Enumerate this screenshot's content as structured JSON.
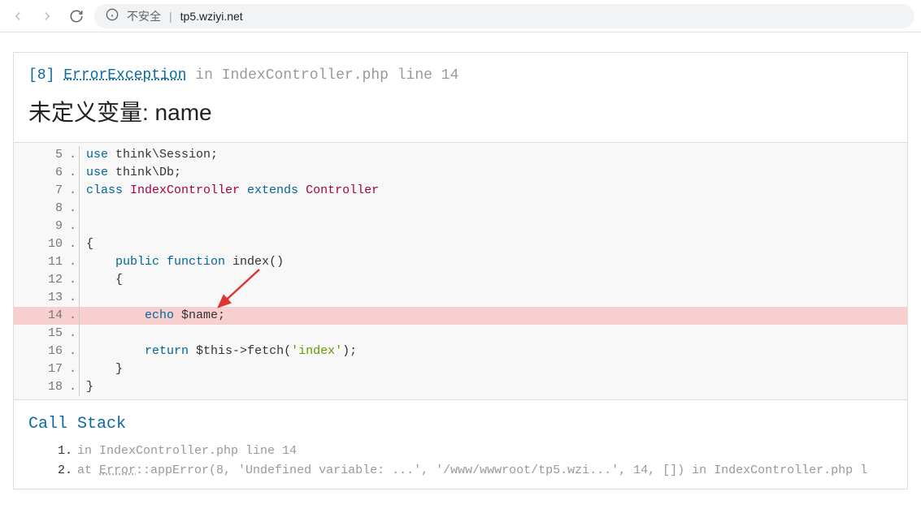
{
  "browser": {
    "security_label": "不安全",
    "url": "tp5.wziyi.net"
  },
  "error": {
    "code": "[8]",
    "exception": "ErrorException",
    "in_word": "in",
    "file": "IndexController.php",
    "line_word": "line",
    "line_no": "14",
    "title": "未定义变量: name"
  },
  "code": {
    "lines": [
      {
        "n": "5",
        "ind": "",
        "tokens": [
          {
            "t": "use ",
            "c": "kw"
          },
          {
            "t": "think\\Session",
            "c": "pn"
          },
          {
            "t": ";",
            "c": "pn"
          }
        ]
      },
      {
        "n": "6",
        "ind": "",
        "tokens": [
          {
            "t": "use ",
            "c": "kw"
          },
          {
            "t": "think\\Db",
            "c": "pn"
          },
          {
            "t": ";",
            "c": "pn"
          }
        ]
      },
      {
        "n": "7",
        "ind": "",
        "tokens": [
          {
            "t": "class ",
            "c": "kw"
          },
          {
            "t": "IndexController",
            "c": "cls"
          },
          {
            "t": " extends ",
            "c": "kw"
          },
          {
            "t": "Controller",
            "c": "cls"
          }
        ]
      },
      {
        "n": "8",
        "ind": "",
        "tokens": []
      },
      {
        "n": "9",
        "ind": "",
        "tokens": []
      },
      {
        "n": "10",
        "ind": "",
        "tokens": [
          {
            "t": "{",
            "c": "pn"
          }
        ]
      },
      {
        "n": "11",
        "ind": "    ",
        "tokens": [
          {
            "t": "public ",
            "c": "kw"
          },
          {
            "t": "function ",
            "c": "kw"
          },
          {
            "t": "index",
            "c": "fn"
          },
          {
            "t": "()",
            "c": "pn"
          }
        ]
      },
      {
        "n": "12",
        "ind": "    ",
        "tokens": [
          {
            "t": "{",
            "c": "pn"
          }
        ]
      },
      {
        "n": "13",
        "ind": "",
        "tokens": []
      },
      {
        "n": "14",
        "hl": true,
        "ind": "        ",
        "tokens": [
          {
            "t": "echo ",
            "c": "kw"
          },
          {
            "t": "$name",
            "c": "var"
          },
          {
            "t": ";",
            "c": "pn"
          }
        ]
      },
      {
        "n": "15",
        "ind": "",
        "tokens": []
      },
      {
        "n": "16",
        "ind": "        ",
        "tokens": [
          {
            "t": "return ",
            "c": "kw"
          },
          {
            "t": "$this",
            "c": "var"
          },
          {
            "t": "->",
            "c": "pn"
          },
          {
            "t": "fetch",
            "c": "fn"
          },
          {
            "t": "(",
            "c": "pn"
          },
          {
            "t": "'index'",
            "c": "str"
          },
          {
            "t": ");",
            "c": "pn"
          }
        ]
      },
      {
        "n": "17",
        "ind": "    ",
        "tokens": [
          {
            "t": "}",
            "c": "pn"
          }
        ]
      },
      {
        "n": "18",
        "ind": "",
        "tokens": [
          {
            "t": "}",
            "c": "pn"
          }
        ]
      }
    ]
  },
  "callstack": {
    "title": "Call Stack",
    "items": [
      {
        "n": "1.",
        "text_parts": [
          {
            "t": "in ",
            "c": "dim"
          },
          {
            "t": "IndexController.php line 14",
            "c": "dim"
          }
        ]
      },
      {
        "n": "2.",
        "text_parts": [
          {
            "t": "at ",
            "c": "dim"
          },
          {
            "t": "Error",
            "c": "dim u"
          },
          {
            "t": "::appError(8, 'Undefined variable: ...', '/www/wwwroot/tp5.wzi...', 14, []) in ",
            "c": "dim"
          },
          {
            "t": "IndexController.php l",
            "c": "dim"
          }
        ]
      }
    ]
  }
}
